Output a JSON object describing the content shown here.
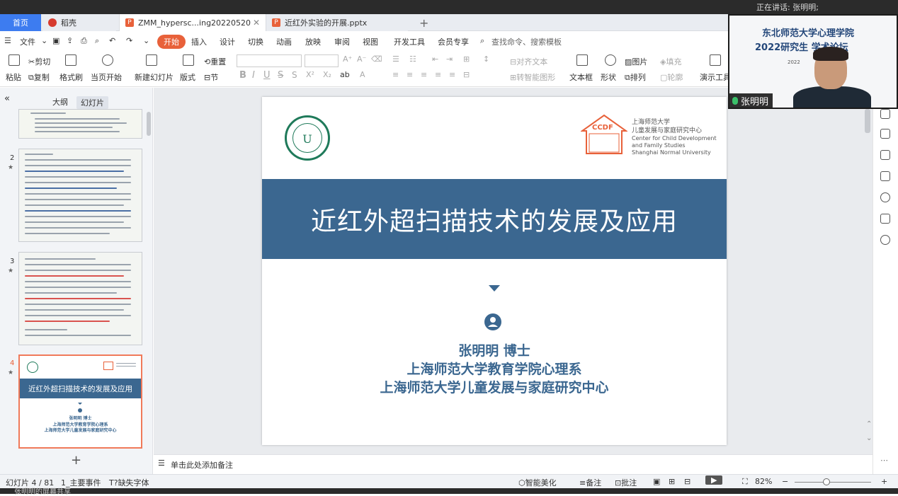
{
  "top": {
    "speaking": "正在讲话: 张明明;"
  },
  "tabs": [
    {
      "label": "首页"
    },
    {
      "label": "稻壳"
    },
    {
      "label": "ZMM_hypersc...ing20220520"
    },
    {
      "label": "近红外实验的开展.pptx"
    }
  ],
  "menu": [
    "文件",
    "开始",
    "插入",
    "设计",
    "切换",
    "动画",
    "放映",
    "审阅",
    "视图",
    "开发工具",
    "会员专享"
  ],
  "search_placeholder": "查找命令、搜索模板",
  "toolbar": {
    "paste": "粘贴",
    "cut": "剪切",
    "copy": "复制",
    "format_painter": "格式刷",
    "from_current": "当页开始",
    "new_slide": "新建幻灯片",
    "layout": "版式",
    "reset": "重置",
    "section": "节",
    "align_text": "对齐文本",
    "convert_smartart": "转智能图形",
    "textbox": "文本框",
    "shape": "形状",
    "picture": "图片",
    "fill": "填充",
    "arrange": "排列",
    "outline": "轮廓",
    "presenter": "演示工具"
  },
  "left_panel": {
    "tab_outline": "大纲",
    "tab_slides": "幻灯片",
    "slides": [
      {
        "num": "2"
      },
      {
        "num": "3"
      },
      {
        "num": "4",
        "title": "近红外超扫描技术的发展及应用",
        "author": "张明明 博士",
        "aff1": "上海师范大学教育学院心理系",
        "aff2": "上海师范大学儿童发展与家庭研究中心"
      }
    ]
  },
  "slide": {
    "title": "近红外超扫描技术的发展及应用",
    "author": "张明明  博士",
    "affiliation1": "上海师范大学教育学院心理系",
    "affiliation2": "上海师范大学儿童发展与家庭研究中心",
    "ccdf_badge": "CCDF",
    "ccdf_cn": "上海师范大学",
    "ccdf_cn2": "儿童发展与家庭研究中心",
    "ccdf_en1": "Center for Child Development",
    "ccdf_en2": "and Family Studies",
    "ccdf_en3": "Shanghai Normal University"
  },
  "notes_placeholder": "单击此处添加备注",
  "status": {
    "slide_count": "幻灯片 4 / 81",
    "theme": "1_主要事件",
    "missing_font": "缺失字体",
    "smart_beautify": "智能美化",
    "notes": "备注",
    "comments": "批注",
    "zoom": "82%"
  },
  "video": {
    "line1": "东北师范大学心理学院",
    "line2": "2022研究生   学术论坛",
    "line3": "2022",
    "name": "张明明"
  },
  "bottom": {
    "text": "张明明的屏幕共享"
  },
  "colors": {
    "accent": "#e8613a",
    "slide_blue": "#3b6790",
    "tab_blue": "#3d7cf0"
  }
}
